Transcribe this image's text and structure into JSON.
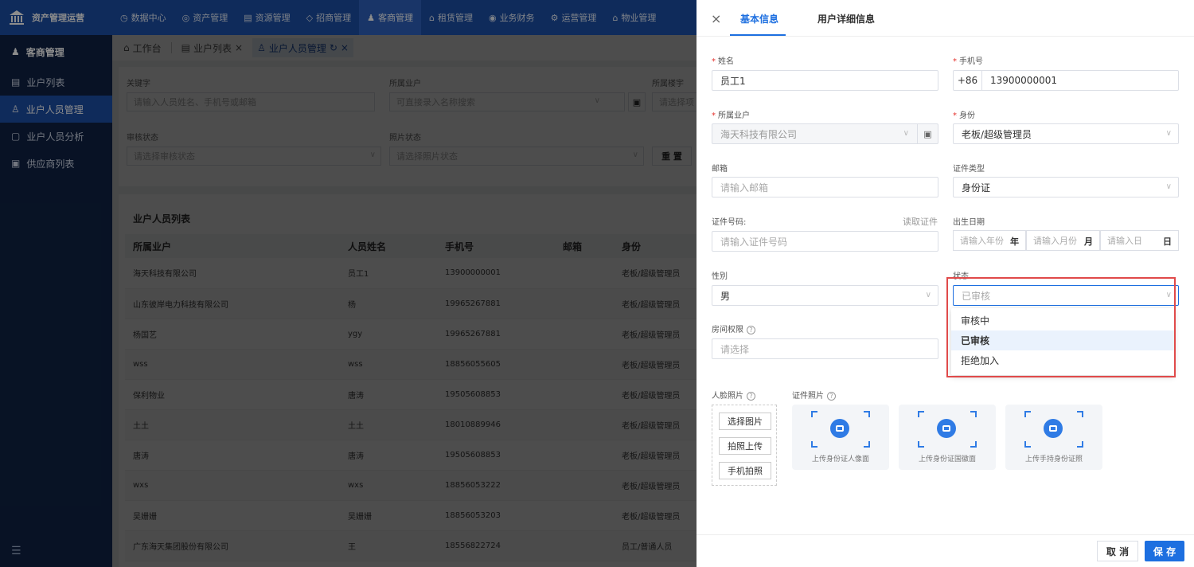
{
  "app": {
    "logo_text": "资产管理运营",
    "topnav": [
      {
        "icon": "◷",
        "label": "数据中心"
      },
      {
        "icon": "◎",
        "label": "资产管理"
      },
      {
        "icon": "▤",
        "label": "资源管理"
      },
      {
        "icon": "◇",
        "label": "招商管理"
      },
      {
        "icon": "♟",
        "label": "客商管理"
      },
      {
        "icon": "⌂",
        "label": "租赁管理"
      },
      {
        "icon": "◉",
        "label": "业务财务"
      },
      {
        "icon": "⚙",
        "label": "运营管理"
      },
      {
        "icon": "⌂",
        "label": "物业管理"
      }
    ]
  },
  "sidebar": {
    "head": "客商管理",
    "items": [
      {
        "label": "业户列表"
      },
      {
        "label": "业户人员管理"
      },
      {
        "label": "业户人员分析"
      },
      {
        "label": "供应商列表"
      }
    ],
    "foot_icon": "☰"
  },
  "tabs": {
    "t1": "工作台",
    "t2": "业户列表",
    "t3": "业户人员管理"
  },
  "filter": {
    "keyword_label": "关键字",
    "keyword_placeholder": "请输入人员姓名、手机号或邮箱",
    "owner_label": "所属业户",
    "owner_placeholder": "可直接录入名称搜索",
    "building_label": "所属楼宇",
    "building_placeholder": "请选择项",
    "audit_label": "审核状态",
    "audit_placeholder": "请选择审核状态",
    "photo_label": "照片状态",
    "photo_placeholder": "请选择照片状态",
    "reset_label": "重 置"
  },
  "list": {
    "title": "业户人员列表",
    "headers": [
      "所属业户",
      "人员姓名",
      "手机号",
      "邮箱",
      "身份"
    ],
    "rows": [
      [
        "海天科技有限公司",
        "员工1",
        "13900000001",
        "",
        "老板/超级管理员"
      ],
      [
        "山东彼岸电力科技有限公司",
        "杨",
        "19965267881",
        "",
        "老板/超级管理员"
      ],
      [
        "杨国艺",
        "ygy",
        "19965267881",
        "",
        "老板/超级管理员"
      ],
      [
        "wss",
        "wss",
        "18856055605",
        "",
        "老板/超级管理员"
      ],
      [
        "保利物业",
        "唐涛",
        "19505608853",
        "",
        "老板/超级管理员"
      ],
      [
        "土土",
        "土土",
        "18010889946",
        "",
        "老板/超级管理员"
      ],
      [
        "唐涛",
        "唐涛",
        "19505608853",
        "",
        "老板/超级管理员"
      ],
      [
        "wxs",
        "wxs",
        "18856053222",
        "",
        "老板/超级管理员"
      ],
      [
        "吴姗姗",
        "吴姗姗",
        "18856053203",
        "",
        "老板/超级管理员"
      ],
      [
        "广东海天集团股份有限公司",
        "王",
        "18556822724",
        "",
        "员工/普通人员"
      ]
    ]
  },
  "drawer": {
    "tab_basic": "基本信息",
    "tab_detail": "用户详细信息",
    "name_label": "姓名",
    "name_value": "员工1",
    "phone_label": "手机号",
    "phone_prefix": "+86",
    "phone_value": "13900000001",
    "owner_label": "所属业户",
    "owner_value": "海天科技有限公司",
    "identity_label": "身份",
    "identity_value": "老板/超级管理员",
    "email_label": "邮箱",
    "email_placeholder": "请输入邮箱",
    "cert_type_label": "证件类型",
    "cert_type_value": "身份证",
    "cert_no_label": "证件号码:",
    "read_cert_link": "读取证件",
    "cert_no_placeholder": "请输入证件号码",
    "birth_label": "出生日期",
    "birth_year_placeholder": "请输入年份",
    "birth_year_unit": "年",
    "birth_month_placeholder": "请输入月份",
    "birth_month_unit": "月",
    "birth_day_placeholder": "请输入日",
    "birth_day_unit": "日",
    "gender_label": "性别",
    "gender_value": "男",
    "status_label": "状态",
    "status_placeholder": "已审核",
    "status_options": [
      "审核中",
      "已审核",
      "拒绝加入"
    ],
    "room_label": "房间权限",
    "room_placeholder": "请选择",
    "face_label": "人脸照片",
    "cert_photo_label": "证件照片",
    "upload_buttons": [
      "选择图片",
      "拍照上传",
      "手机拍照"
    ],
    "cards": [
      "上传身份证人像面",
      "上传身份证国徽面",
      "上传手持身份证照"
    ],
    "cancel_label": "取 消",
    "save_label": "保 存",
    "close_icon": "×"
  }
}
